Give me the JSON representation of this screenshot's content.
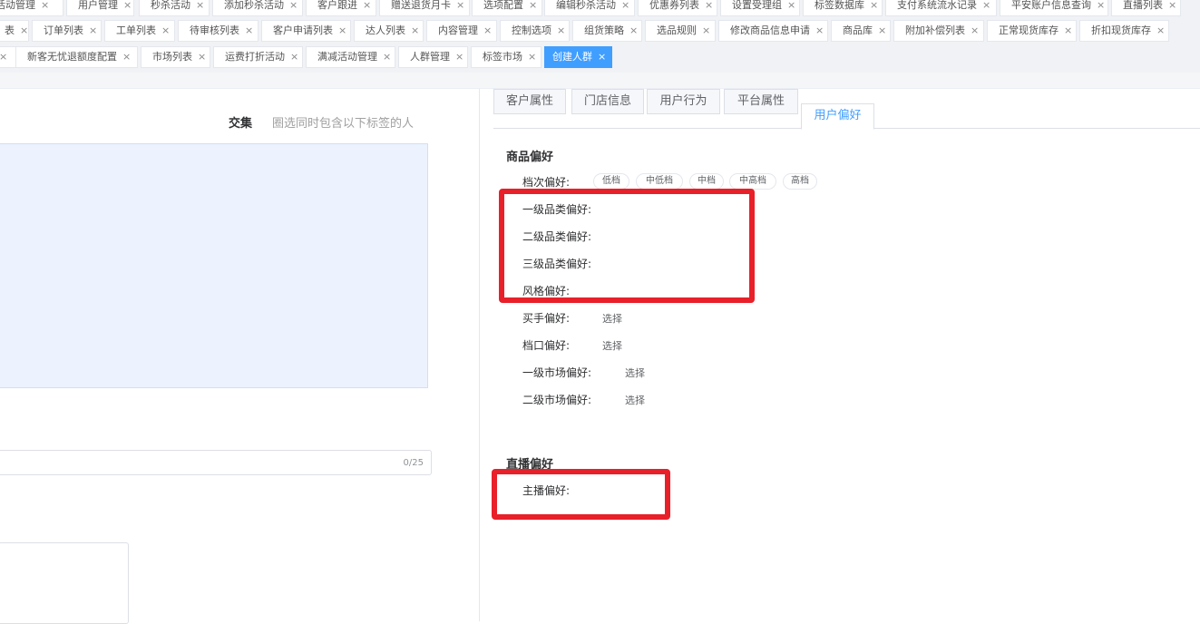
{
  "tabs": {
    "row1": [
      {
        "label": "活动管理",
        "partial": "左截断"
      },
      {
        "label": "用户管理"
      },
      {
        "label": "秒杀活动"
      },
      {
        "label": "添加秒杀活动"
      },
      {
        "label": "客户跟进"
      },
      {
        "label": "赠送退货月卡"
      },
      {
        "label": "选项配置"
      },
      {
        "label": "编辑秒杀活动"
      },
      {
        "label": "优惠券列表"
      },
      {
        "label": "设置受理组"
      },
      {
        "label": "标签数据库"
      },
      {
        "label": "支付系统流水记录"
      },
      {
        "label": "平安账户信息查询"
      },
      {
        "label": "直播列表"
      }
    ],
    "row2": [
      {
        "label": "表"
      },
      {
        "label": "订单列表"
      },
      {
        "label": "工单列表"
      },
      {
        "label": "待审核列表"
      },
      {
        "label": "客户申请列表"
      },
      {
        "label": "达人列表"
      },
      {
        "label": "内容管理"
      },
      {
        "label": "控制选项"
      },
      {
        "label": "组货策略"
      },
      {
        "label": "选品规则"
      },
      {
        "label": "修改商品信息申请"
      },
      {
        "label": "商品库"
      },
      {
        "label": "附加补偿列表"
      },
      {
        "label": "正常现货库存"
      },
      {
        "label": "折扣现货库存"
      }
    ],
    "row3": [
      {
        "label": ""
      },
      {
        "label": "新客无忧退额度配置"
      },
      {
        "label": "市场列表"
      },
      {
        "label": "运费打折活动"
      },
      {
        "label": "满减活动管理"
      },
      {
        "label": "人群管理"
      },
      {
        "label": "标签市场"
      },
      {
        "label": "创建人群",
        "active": true
      }
    ],
    "close_glyph": "×"
  },
  "left": {
    "jj_label": "交集",
    "jj_desc": "圈选同时包含以下标签的人",
    "counter": "0/25"
  },
  "right": {
    "category_tabs": [
      "客户属性",
      "门店信息",
      "用户行为",
      "平台属性",
      "用户偏好"
    ],
    "active_tab": "用户偏好",
    "goods_title": "商品偏好",
    "grade_label": "档次偏好:",
    "grade_chips": [
      "低档",
      "中低档",
      "中档",
      "中高档",
      "高档"
    ],
    "cat1_label": "一级品类偏好:",
    "cat2_label": "二级品类偏好:",
    "cat3_label": "三级品类偏好:",
    "style_label": "风格偏好:",
    "buyer_label": "买手偏好:",
    "stall_label": "档口偏好:",
    "market1_label": "一级市场偏好:",
    "market2_label": "二级市场偏好:",
    "select_text": "选择",
    "live_title": "直播偏好",
    "anchor_label": "主播偏好:"
  },
  "annotation": {
    "color": "#e8202a"
  }
}
